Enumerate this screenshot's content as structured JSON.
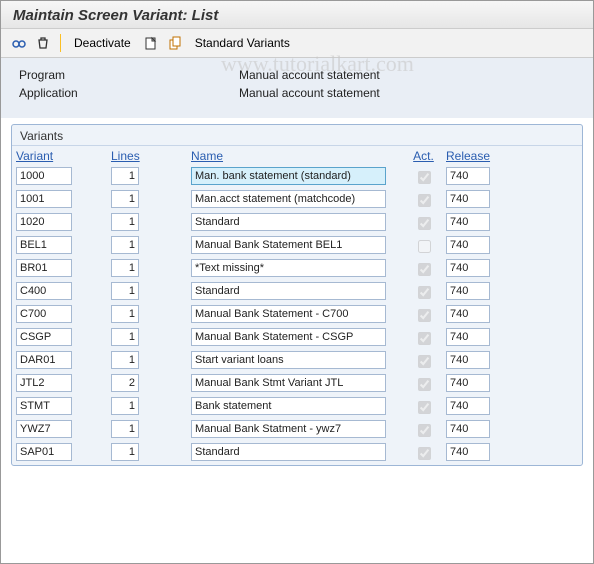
{
  "watermark": "www.tutorialkart.com",
  "header": {
    "title": "Maintain Screen Variant: List"
  },
  "toolbar": {
    "deactivate": "Deactivate",
    "standard_variants": "Standard Variants"
  },
  "info": {
    "program_label": "Program",
    "program_value": "Manual account statement",
    "application_label": "Application",
    "application_value": "Manual account statement"
  },
  "panel": {
    "title": "Variants",
    "headers": {
      "variant": "Variant",
      "lines": "Lines",
      "name": "Name",
      "act": "Act.",
      "release": "Release"
    },
    "rows": [
      {
        "variant": "1000",
        "lines": "1",
        "name": "Man. bank statement (standard)",
        "act": true,
        "release": "740",
        "selected": true
      },
      {
        "variant": "1001",
        "lines": "1",
        "name": "Man.acct statement (matchcode)",
        "act": true,
        "release": "740"
      },
      {
        "variant": "1020",
        "lines": "1",
        "name": "Standard",
        "act": true,
        "release": "740"
      },
      {
        "variant": "BEL1",
        "lines": "1",
        "name": "Manual Bank Statement  BEL1",
        "act": false,
        "release": "740"
      },
      {
        "variant": "BR01",
        "lines": "1",
        "name": "*Text missing*",
        "act": true,
        "release": "740"
      },
      {
        "variant": "C400",
        "lines": "1",
        "name": "Standard",
        "act": true,
        "release": "740"
      },
      {
        "variant": "C700",
        "lines": "1",
        "name": "Manual Bank Statement - C700",
        "act": true,
        "release": "740"
      },
      {
        "variant": "CSGP",
        "lines": "1",
        "name": "Manual Bank Statement - CSGP",
        "act": true,
        "release": "740"
      },
      {
        "variant": "DAR01",
        "lines": "1",
        "name": "Start variant loans",
        "act": true,
        "release": "740"
      },
      {
        "variant": "JTL2",
        "lines": "2",
        "name": "Manual Bank Stmt Variant JTL",
        "act": true,
        "release": "740"
      },
      {
        "variant": "STMT",
        "lines": "1",
        "name": "Bank statement",
        "act": true,
        "release": "740"
      },
      {
        "variant": "YWZ7",
        "lines": "1",
        "name": "Manual Bank Statment - ywz7",
        "act": true,
        "release": "740"
      },
      {
        "variant": "SAP01",
        "lines": "1",
        "name": "Standard",
        "act": true,
        "release": "740"
      }
    ]
  }
}
